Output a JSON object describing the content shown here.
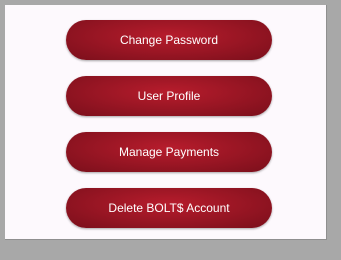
{
  "colors": {
    "background": "#a8a8a8",
    "panel": "#fdf9fd",
    "button": "#961523",
    "button_text": "#ffffff"
  },
  "menu": {
    "buttons": [
      {
        "label": "Change Password"
      },
      {
        "label": "User Profile"
      },
      {
        "label": "Manage Payments"
      },
      {
        "label": "Delete BOLT$ Account"
      }
    ]
  }
}
